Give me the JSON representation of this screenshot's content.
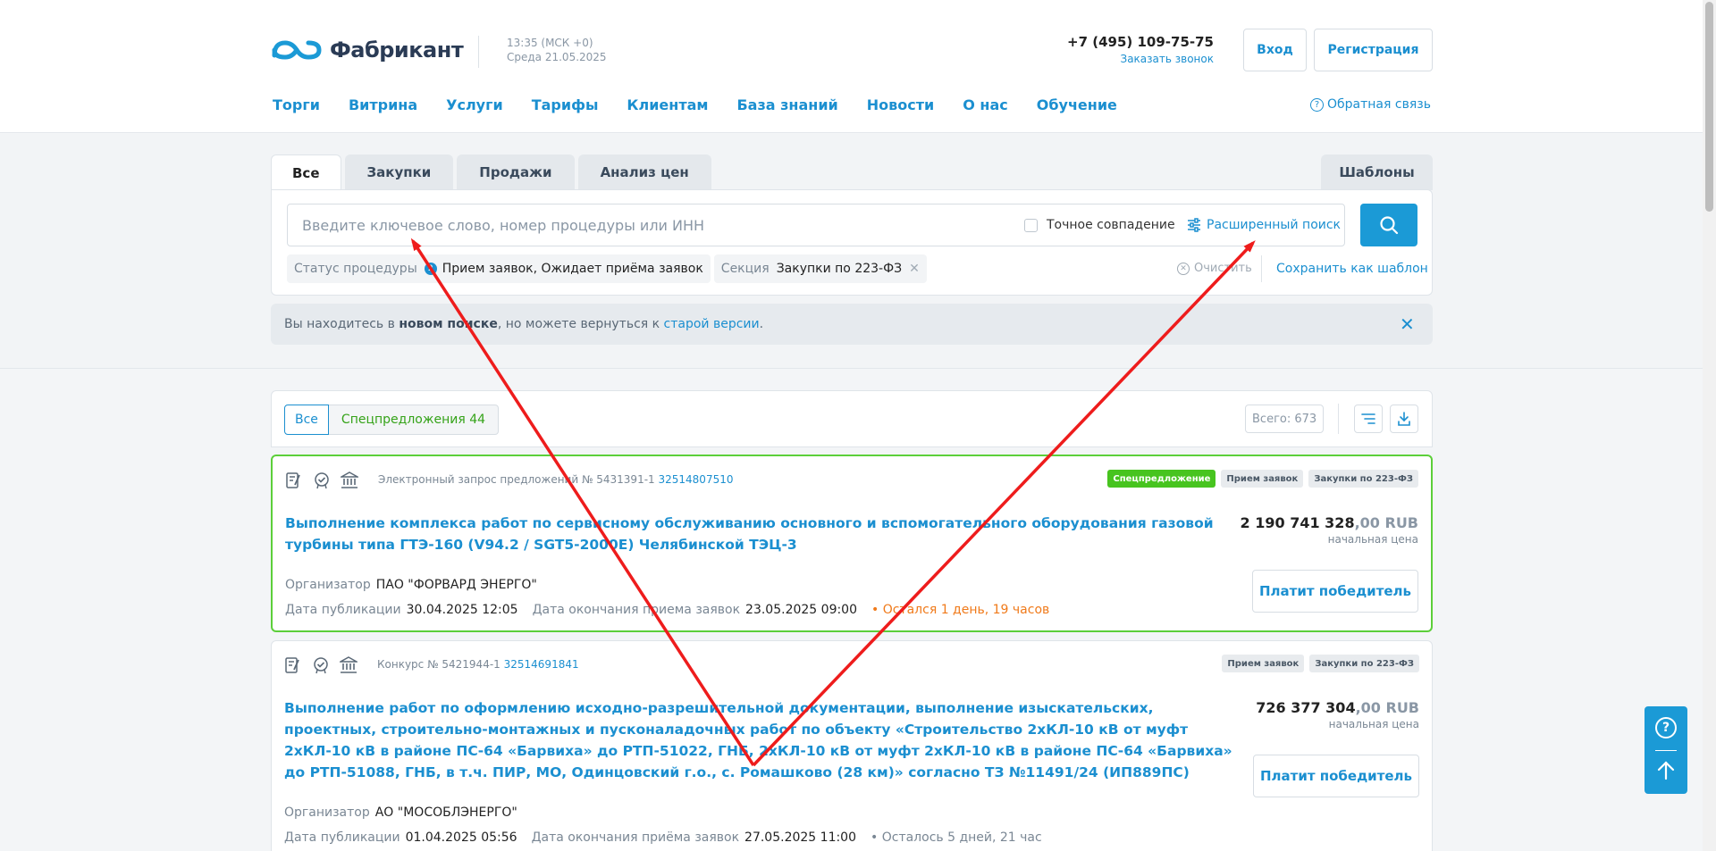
{
  "header": {
    "logo_text": "Фабрикант",
    "time": "13:35 (МСК +0)",
    "date": "Среда 21.05.2025",
    "phone": "+7 (495) 109-75-75",
    "callback": "Заказать звонок",
    "login": "Вход",
    "register": "Регистрация",
    "nav": [
      "Торги",
      "Витрина",
      "Услуги",
      "Тарифы",
      "Клиентам",
      "База знаний",
      "Новости",
      "О нас",
      "Обучение"
    ],
    "feedback": "Обратная связь"
  },
  "search": {
    "tabs": [
      "Все",
      "Закупки",
      "Продажи",
      "Анализ цен"
    ],
    "templates_tab": "Шаблоны",
    "placeholder": "Введите ключевое слово, номер процедуры или ИНН",
    "exact_match": "Точное совпадение",
    "advanced": "Расширенный поиск",
    "filters": [
      {
        "label": "Статус процедуры",
        "count": "2",
        "value": "Прием заявок, Ожидает приёма заявок"
      },
      {
        "label": "Секция",
        "value": "Закупки по 223-ФЗ"
      }
    ],
    "clear": "Очистить",
    "save_template": "Сохранить как шаблон"
  },
  "notice": {
    "prefix": "Вы находитесь в ",
    "bold": "новом поиске",
    "middle": ", но можете вернуться к ",
    "link": "старой версии",
    "suffix": "."
  },
  "results": {
    "seg_all": "Все",
    "seg_special": "Спецпредложения 44",
    "total": "Всего: 673",
    "items": [
      {
        "type": "Электронный запрос предложений № 5431391-1",
        "number": "32514807510",
        "badges": [
          "Спецпредложение",
          "Прием заявок",
          "Закупки по 223-ФЗ"
        ],
        "title": "Выполнение комплекса работ по сервисному обслуживанию основного и вспомогательного оборудования газовой турбины типа ГТЭ-160 (V94.2 / SGT5-2000E) Челябинской ТЭЦ-3",
        "price_main": "2 190 741 328",
        "price_kop": ",00 RUB",
        "price_caption": "начальная цена",
        "button": "Платит победитель",
        "org_label": "Организатор",
        "org": "ПАО \"ФОРВАРД ЭНЕРГО\"",
        "pub_label": "Дата публикации",
        "pub": "30.04.2025 12:05",
        "end_label": "Дата окончания приема заявок",
        "end": "23.05.2025 09:00",
        "left": "• Остался 1 день, 19 часов"
      },
      {
        "type": "Конкурс № 5421944-1",
        "number": "32514691841",
        "badges": [
          "Прием заявок",
          "Закупки по 223-ФЗ"
        ],
        "title": "Выполнение работ по оформлению исходно-разрешительной документации, выполнение изыскательских, проектных, строительно-монтажных и пусконаладочных работ по объекту «Строительство 2хКЛ-10 кВ от муфт 2хКЛ-10 кВ в районе ПС-64 «Барвиха» до РТП-51022, ГНБ, 2хКЛ-10 кВ от муфт 2хКЛ-10 кВ в районе ПС-64 «Барвиха» до РТП-51088, ГНБ, в т.ч. ПИР, МО, Одинцовский г.о., с. Ромашково (28 км)» согласно ТЗ №11491/24 (ИП889ПС)",
        "price_main": "726 377 304",
        "price_kop": ",00 RUB",
        "price_caption": "начальная цена",
        "button": "Платит победитель",
        "org_label": "Организатор",
        "org": "АО \"МОСОБЛЭНЕРГО\"",
        "pub_label": "Дата публикации",
        "pub": "01.04.2025 05:56",
        "end_label": "Дата окончания приёма заявок",
        "end": "27.05.2025 11:00",
        "left": "• Осталось 5 дней, 21 час"
      }
    ]
  },
  "colors": {
    "accent": "#1b8fd0",
    "special_border": "#5ccf3a",
    "arrow": "#ee1c1c"
  }
}
